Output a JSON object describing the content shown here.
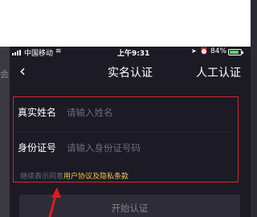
{
  "background": {
    "left_strip_text": "会"
  },
  "status_bar": {
    "carrier": "中国移动",
    "wifi_icon": "wifi-icon",
    "time": "上午9:31",
    "battery_percent": "84%",
    "battery_level": 0.84,
    "battery_color": "#4cd964"
  },
  "nav": {
    "back_icon": "‹",
    "title": "实名认证",
    "action": "人工认证"
  },
  "form": {
    "name_label": "真实姓名",
    "name_placeholder": "请输入姓名",
    "name_value": "",
    "id_label": "身份证号",
    "id_placeholder": "请输入身份证号码",
    "id_value": ""
  },
  "agreement": {
    "prefix": "继续表示同意",
    "link": "用户协议及隐私条款"
  },
  "start_button": {
    "label": "开始认证"
  },
  "colors": {
    "highlight_box": "#d9262b",
    "link": "#f3c54a",
    "page_bg": "#1b1a25"
  }
}
